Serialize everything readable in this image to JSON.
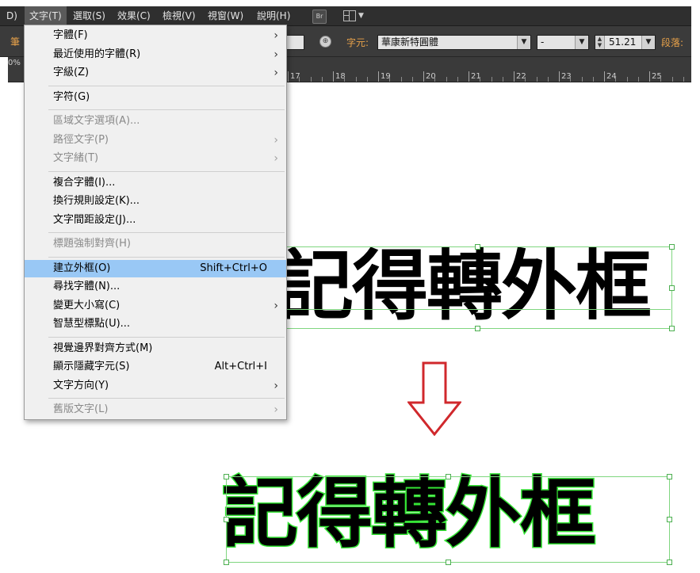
{
  "menubar": {
    "items": [
      {
        "label": "D)"
      },
      {
        "label": "文字(T)"
      },
      {
        "label": "選取(S)"
      },
      {
        "label": "效果(C)"
      },
      {
        "label": "檢視(V)"
      },
      {
        "label": "視窗(W)"
      },
      {
        "label": "說明(H)"
      }
    ],
    "bridge_icon": "Br",
    "arrange_icon": "arrange-documents-icon"
  },
  "control_bar": {
    "stroke_label": "筆",
    "font_label": "字元:",
    "font_family": "華康新特圓體",
    "font_style": "-",
    "font_size": "51.21",
    "paragraph_label": "段落:"
  },
  "ruler": {
    "zoom_fragment": "0%",
    "numbers": [
      "17",
      "18",
      "19",
      "20",
      "21",
      "22",
      "23",
      "24",
      "25"
    ]
  },
  "type_menu": {
    "items": [
      {
        "label": "字體(F)",
        "shortcut": "",
        "submenu": true,
        "disabled": false
      },
      {
        "label": "最近使用的字體(R)",
        "shortcut": "",
        "submenu": true,
        "disabled": false
      },
      {
        "label": "字級(Z)",
        "shortcut": "",
        "submenu": true,
        "disabled": false
      },
      {
        "label": "字符(G)",
        "shortcut": "",
        "submenu": false,
        "disabled": false
      },
      {
        "label": "區域文字選項(A)...",
        "shortcut": "",
        "submenu": false,
        "disabled": true
      },
      {
        "label": "路徑文字(P)",
        "shortcut": "",
        "submenu": true,
        "disabled": true
      },
      {
        "label": "文字緒(T)",
        "shortcut": "",
        "submenu": true,
        "disabled": true
      },
      {
        "label": "複合字體(I)...",
        "shortcut": "",
        "submenu": false,
        "disabled": false
      },
      {
        "label": "換行規則設定(K)...",
        "shortcut": "",
        "submenu": false,
        "disabled": false
      },
      {
        "label": "文字間距設定(J)...",
        "shortcut": "",
        "submenu": false,
        "disabled": false
      },
      {
        "label": "標題強制對齊(H)",
        "shortcut": "",
        "submenu": false,
        "disabled": true
      },
      {
        "label": "建立外框(O)",
        "shortcut": "Shift+Ctrl+O",
        "submenu": false,
        "disabled": false,
        "highlighted": true
      },
      {
        "label": "尋找字體(N)...",
        "shortcut": "",
        "submenu": false,
        "disabled": false
      },
      {
        "label": "變更大小寫(C)",
        "shortcut": "",
        "submenu": true,
        "disabled": false
      },
      {
        "label": "智慧型標點(U)...",
        "shortcut": "",
        "submenu": false,
        "disabled": false
      },
      {
        "label": "視覺邊界對齊方式(M)",
        "shortcut": "",
        "submenu": false,
        "disabled": false
      },
      {
        "label": "顯示隱藏字元(S)",
        "shortcut": "Alt+Ctrl+I",
        "submenu": false,
        "disabled": false
      },
      {
        "label": "文字方向(Y)",
        "shortcut": "",
        "submenu": true,
        "disabled": false
      },
      {
        "label": "舊版文字(L)",
        "shortcut": "",
        "submenu": true,
        "disabled": true
      }
    ],
    "submenu_arrow": "›"
  },
  "canvas": {
    "text_before": "記得轉外框",
    "text_after": "記得轉外框",
    "arrow_icon": "down-arrow-icon",
    "arrow_color": "#d0282c",
    "outline_color": "#35e535"
  }
}
